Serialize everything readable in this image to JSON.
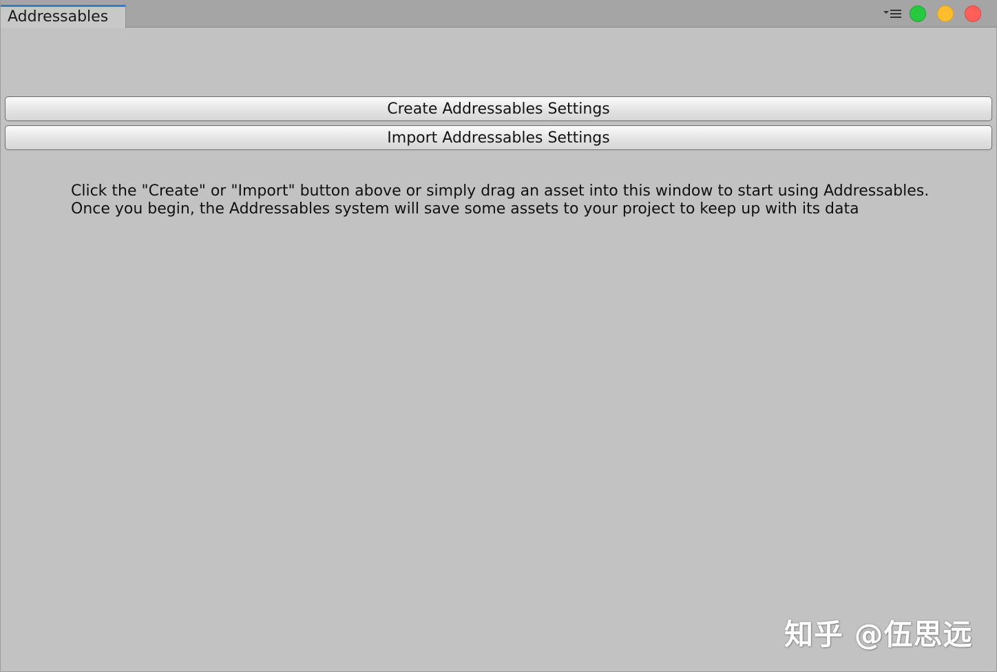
{
  "tab": {
    "title": "Addressables"
  },
  "window_controls": {
    "menu_icon": "dropdown-menu-icon",
    "colors": {
      "green": "#27c93f",
      "yellow": "#ffbd2e",
      "red": "#ff5f57"
    }
  },
  "buttons": {
    "create_label": "Create Addressables Settings",
    "import_label": "Import Addressables Settings"
  },
  "help": {
    "line1": "Click the \"Create\" or \"Import\" button above or simply drag an asset into this window to start using Addressables.",
    "line2": "Once you begin, the Addressables system will save some assets to your project to keep up with its data"
  },
  "watermark": {
    "text": "知乎 @伍思远"
  },
  "colors": {
    "background": "#c2c2c2",
    "tab_accent": "#3a78d0"
  }
}
